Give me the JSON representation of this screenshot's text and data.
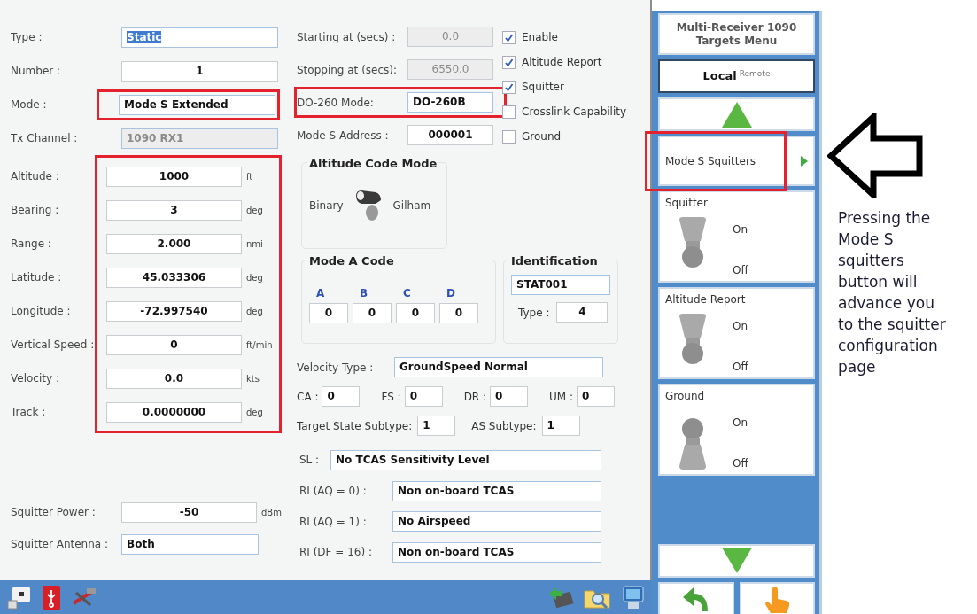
{
  "target_form": {
    "top_fields": [
      {
        "label": "Type :",
        "value": "Static",
        "kind": "select",
        "disabled": false,
        "text_selected": true,
        "highlighted": false
      },
      {
        "label": "Number :",
        "value": "1",
        "kind": "number",
        "disabled": false,
        "text_selected": false,
        "highlighted": false
      },
      {
        "label": "Mode :",
        "value": "Mode S Extended",
        "kind": "select",
        "disabled": false,
        "text_selected": false,
        "highlighted": true
      },
      {
        "label": "Tx Channel :",
        "value": "1090 RX1",
        "kind": "select",
        "disabled": true,
        "text_selected": false,
        "highlighted": false
      }
    ],
    "motion_group": {
      "highlighted": true,
      "fields": [
        {
          "label": "Altitude :",
          "value": "1000",
          "unit": "ft"
        },
        {
          "label": "Bearing :",
          "value": "3",
          "unit": "deg"
        },
        {
          "label": "Range :",
          "value": "2.000",
          "unit": "nmi"
        },
        {
          "label": "Latitude :",
          "value": "45.033306",
          "unit": "deg"
        },
        {
          "label": "Longitude :",
          "value": "-72.997540",
          "unit": "deg"
        },
        {
          "label": "Vertical Speed :",
          "value": "0",
          "unit": "ft/min"
        },
        {
          "label": "Velocity :",
          "value": "0.0",
          "unit": "kts"
        },
        {
          "label": "Track :",
          "value": "0.0000000",
          "unit": "deg"
        }
      ]
    },
    "bottom_fields": [
      {
        "label": "Squitter Power :",
        "value": "-50",
        "kind": "number",
        "unit": "dBm"
      },
      {
        "label": "Squitter Antenna :",
        "value": "Both",
        "kind": "select"
      }
    ],
    "timing_fields": [
      {
        "label": "Starting at (secs) :",
        "value": "0.0",
        "kind": "number",
        "disabled": true,
        "highlighted": false
      },
      {
        "label": "Stopping at (secs):",
        "value": "6550.0",
        "kind": "number",
        "disabled": true,
        "highlighted": false
      },
      {
        "label": "DO-260 Mode:",
        "value": "DO-260B",
        "kind": "select",
        "disabled": false,
        "highlighted": true
      },
      {
        "label": "Mode S Address :",
        "value": "000001",
        "kind": "number",
        "disabled": false,
        "highlighted": false
      }
    ],
    "checkboxes": [
      {
        "label": "Enable",
        "checked": true
      },
      {
        "label": "Altitude Report",
        "checked": true
      },
      {
        "label": "Squitter",
        "checked": true
      },
      {
        "label": "Crosslink Capability",
        "checked": false
      },
      {
        "label": "Ground",
        "checked": false
      }
    ],
    "altitude_code_mode": {
      "title": "Altitude Code Mode",
      "options": [
        "Binary",
        "Gilham"
      ],
      "gilham_selected": false
    },
    "mode_a_code": {
      "title": "Mode A Code",
      "digits": [
        {
          "label": "A",
          "value": "0"
        },
        {
          "label": "B",
          "value": "0"
        },
        {
          "label": "C",
          "value": "0"
        },
        {
          "label": "D",
          "value": "0"
        }
      ]
    },
    "identification": {
      "title": "Identification",
      "callsign": "STAT001",
      "type_label": "Type :",
      "type_value": "4"
    },
    "velocity_type": {
      "label": "Velocity Type :",
      "value": "GroundSpeed Normal"
    },
    "flags": [
      {
        "label": "CA :",
        "value": "0"
      },
      {
        "label": "FS :",
        "value": "0"
      },
      {
        "label": "DR :",
        "value": "0"
      },
      {
        "label": "UM :",
        "value": "0"
      }
    ],
    "subtypes": [
      {
        "label": "Target State Subtype:",
        "value": "1"
      },
      {
        "label": "AS Subtype:",
        "value": "1"
      }
    ],
    "sl": {
      "label": "SL :",
      "value": "No TCAS Sensitivity Level"
    },
    "ri_fields": [
      {
        "label": "RI (AQ = 0) :",
        "value": "Non on-board TCAS"
      },
      {
        "label": "RI (AQ = 1) :",
        "value": "No Airspeed"
      },
      {
        "label": "RI (DF = 16) :",
        "value": "Non on-board TCAS"
      }
    ]
  },
  "menu": {
    "title": "Multi-Receiver 1090 Targets Menu",
    "mode": {
      "primary": "Local",
      "secondary": "Remote"
    },
    "items": [
      {
        "kind": "arrow-up"
      },
      {
        "kind": "link",
        "label": "Mode S Squitters",
        "highlighted": true
      },
      {
        "kind": "toggle",
        "label": "Squitter",
        "on_label": "On",
        "off_label": "Off",
        "on": true
      },
      {
        "kind": "toggle",
        "label": "Altitude Report",
        "on_label": "On",
        "off_label": "Off",
        "on": true
      },
      {
        "kind": "toggle",
        "label": "Ground",
        "on_label": "On",
        "off_label": "Off",
        "on": false
      },
      {
        "kind": "spacer"
      },
      {
        "kind": "arrow-down"
      }
    ],
    "bottom_buttons": [
      {
        "kind": "back"
      },
      {
        "kind": "hand"
      }
    ]
  },
  "annotation": {
    "lines": [
      "Pressing the",
      "Mode S",
      "squitters",
      "button will",
      "advance you",
      "to the squitter",
      "configuration",
      "page"
    ]
  }
}
